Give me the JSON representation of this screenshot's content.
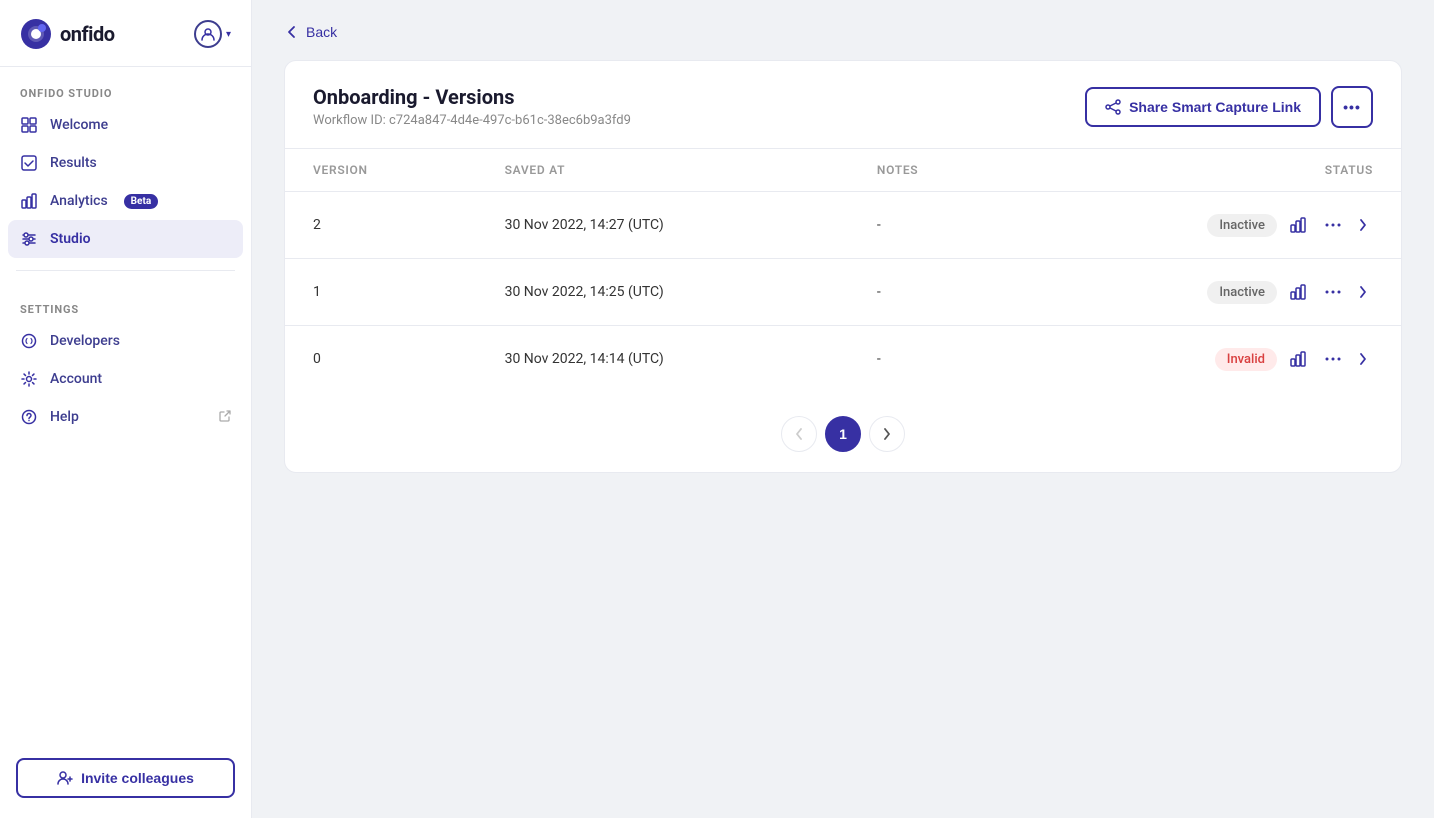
{
  "brand": {
    "logo_text": "onfido",
    "logo_alt": "Onfido logo"
  },
  "sidebar": {
    "studio_section_label": "ONFIDO STUDIO",
    "settings_section_label": "SETTINGS",
    "nav_items_studio": [
      {
        "id": "welcome",
        "label": "Welcome",
        "icon": "grid-icon",
        "active": false
      },
      {
        "id": "results",
        "label": "Results",
        "icon": "check-square-icon",
        "active": false
      },
      {
        "id": "analytics",
        "label": "Analytics",
        "icon": "bar-chart-icon",
        "active": false,
        "badge": "Beta"
      },
      {
        "id": "studio",
        "label": "Studio",
        "icon": "sliders-icon",
        "active": true
      }
    ],
    "nav_items_settings": [
      {
        "id": "developers",
        "label": "Developers",
        "icon": "code-icon",
        "active": false
      },
      {
        "id": "account",
        "label": "Account",
        "icon": "gear-icon",
        "active": false
      },
      {
        "id": "help",
        "label": "Help",
        "icon": "help-circle-icon",
        "active": false,
        "ext": true
      }
    ],
    "invite_btn_label": "Invite colleagues"
  },
  "main": {
    "back_label": "Back",
    "card": {
      "title": "Onboarding - Versions",
      "workflow_id_label": "Workflow ID: c724a847-4d4e-497c-b61c-38ec6b9a3fd9",
      "share_btn_label": "Share Smart Capture Link",
      "more_btn_label": "···"
    },
    "table": {
      "columns": [
        "VERSION",
        "SAVED AT",
        "NOTES",
        "STATUS"
      ],
      "rows": [
        {
          "version": "2",
          "saved_at": "30 Nov 2022, 14:27 (UTC)",
          "notes": "-",
          "status": "Inactive",
          "status_type": "inactive"
        },
        {
          "version": "1",
          "saved_at": "30 Nov 2022, 14:25 (UTC)",
          "notes": "-",
          "status": "Inactive",
          "status_type": "inactive"
        },
        {
          "version": "0",
          "saved_at": "30 Nov 2022, 14:14 (UTC)",
          "notes": "-",
          "status": "Invalid",
          "status_type": "invalid"
        }
      ]
    },
    "pagination": {
      "prev_label": "‹",
      "next_label": "›",
      "current_page": 1,
      "pages": [
        1
      ]
    }
  }
}
